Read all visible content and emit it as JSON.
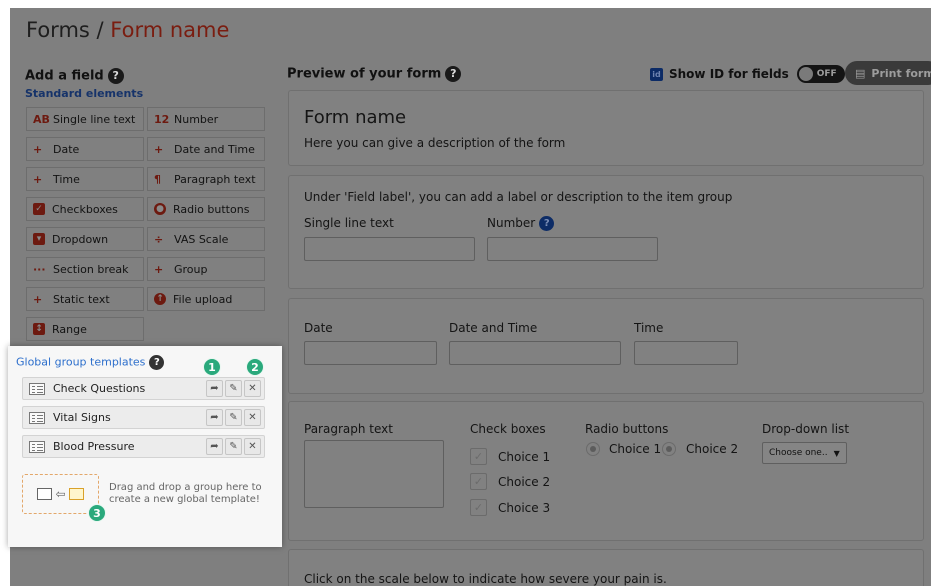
{
  "header": {
    "breadcrumb_root": "Forms",
    "separator": "/",
    "form_name": "Form name"
  },
  "add_field": {
    "title": "Add a field",
    "standard_label": "Standard elements",
    "buttons": [
      {
        "icon": "AB",
        "label": "Single line text"
      },
      {
        "icon": "12",
        "label": "Number"
      },
      {
        "icon": "+",
        "label": "Date"
      },
      {
        "icon": "+",
        "label": "Date and Time"
      },
      {
        "icon": "+",
        "label": "Time"
      },
      {
        "icon": "¶",
        "label": "Paragraph text"
      },
      {
        "icon": "✓",
        "label": "Checkboxes"
      },
      {
        "icon": "●",
        "label": "Radio buttons"
      },
      {
        "icon": "▾",
        "label": "Dropdown"
      },
      {
        "icon": "÷",
        "label": "VAS Scale"
      },
      {
        "icon": "···",
        "label": "Section break"
      },
      {
        "icon": "+",
        "label": "Group"
      },
      {
        "icon": "+",
        "label": "Static text"
      },
      {
        "icon": "↑",
        "label": "File upload"
      },
      {
        "icon": "↕",
        "label": "Range"
      }
    ]
  },
  "templates": {
    "title": "Global group templates",
    "items": [
      "Check Questions",
      "Vital Signs",
      "Blood Pressure"
    ],
    "drop_text_1": "Drag and drop a group here to",
    "drop_text_2": "create a new global template!",
    "badges": [
      "1",
      "2",
      "3"
    ]
  },
  "preview": {
    "title": "Preview of your form",
    "show_id_label": "Show ID for fields",
    "toggle_state": "OFF",
    "print_label": "Print form",
    "form_title": "Form name",
    "form_description": "Here you can give a description of the form",
    "group_note": "Under 'Field label', you can add a label or description to the item group",
    "single_line_label": "Single line text",
    "number_label": "Number",
    "date_label": "Date",
    "datetime_label": "Date and Time",
    "time_label": "Time",
    "paragraph_label": "Paragraph text",
    "checkboxes_label": "Check boxes",
    "checkbox_choices": [
      "Choice 1",
      "Choice 2",
      "Choice 3"
    ],
    "radio_label": "Radio buttons",
    "radio_choices": [
      "Choice 1",
      "Choice 2"
    ],
    "dropdown_label": "Drop-down list",
    "dropdown_value": "Choose one..",
    "scale_note": "Click on the scale below to indicate how severe your pain is."
  },
  "colors": {
    "accent_green": "#2aa97c",
    "link_blue": "#2d6fcc",
    "brand_red": "#c0361c"
  }
}
